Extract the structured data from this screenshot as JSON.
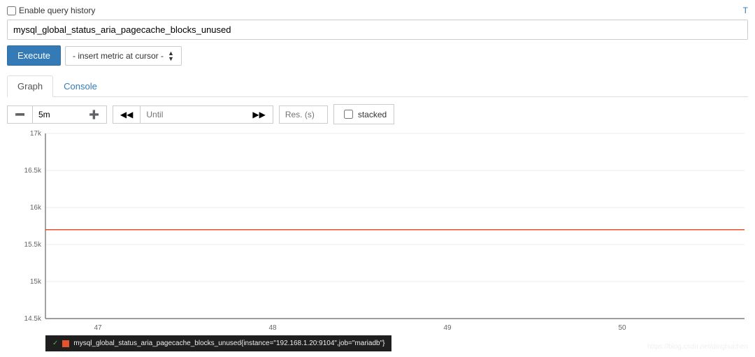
{
  "header": {
    "enable_history_label": "Enable query history",
    "corner_link": "T"
  },
  "query": {
    "value": "mysql_global_status_aria_pagecache_blocks_unused"
  },
  "exec": {
    "execute_label": "Execute",
    "metric_select_label": "- insert metric at cursor -"
  },
  "tabs": {
    "graph": "Graph",
    "console": "Console"
  },
  "controls": {
    "duration": "5m",
    "until_placeholder": "Until",
    "res_placeholder": "Res. (s)",
    "stacked_label": "stacked"
  },
  "chart_data": {
    "type": "line",
    "series": [
      {
        "name": "mysql_global_status_aria_pagecache_blocks_unused{instance=\"192.168.1.20:9104\",job=\"mariadb\"}",
        "value": 15700
      }
    ],
    "y_ticks": [
      "14.5k",
      "15k",
      "15.5k",
      "16k",
      "16.5k",
      "17k"
    ],
    "y_tick_values": [
      14500,
      15000,
      15500,
      16000,
      16500,
      17000
    ],
    "x_ticks": [
      "47",
      "48",
      "49",
      "50"
    ]
  },
  "legend": {
    "text": "mysql_global_status_aria_pagecache_blocks_unused{instance=\"192.168.1.20:9104\",job=\"mariadb\"}"
  },
  "watermark": "https://blog.csdn.net/dinghuchen"
}
